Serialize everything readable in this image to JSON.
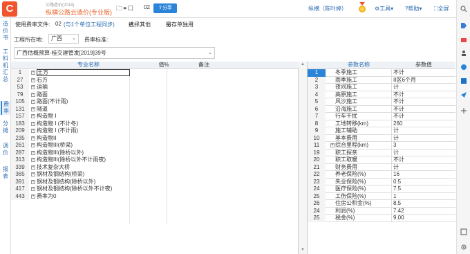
{
  "header": {
    "logo_letter": "C",
    "subtitle": "公路造价(2018)",
    "title": "纵横公路云造价(专业版)",
    "count": "02",
    "share": "分享",
    "user": "纵横（陈叶婷）",
    "menus": [
      "工具",
      "帮助",
      "全屏"
    ]
  },
  "leftnav": [
    {
      "label": "造价书",
      "active": false
    },
    {
      "label": "工料机汇总",
      "active": false
    },
    {
      "label": "费率",
      "active": true
    },
    {
      "label": "分摊",
      "active": false
    },
    {
      "label": "调价",
      "active": false
    },
    {
      "label": "报表",
      "active": false
    }
  ],
  "toolbar": {
    "rate_file_label": "使用费率文件:",
    "rate_file_value": "02",
    "sync_link": "(与1个单位工程同步)",
    "choose_other": "选择其他",
    "save_as": "另存单独用"
  },
  "filters": {
    "region_label": "工程所在地:",
    "region_value": "广西",
    "standard_label": "费率标准:",
    "standard_value": "广西估概预算-桂交建管发[2019]39号"
  },
  "left_table": {
    "headers": [
      "专业名称",
      "值%",
      "备注"
    ],
    "rows": [
      {
        "num": "1",
        "name": "土方"
      },
      {
        "num": "27",
        "name": "石方"
      },
      {
        "num": "53",
        "name": "运输"
      },
      {
        "num": "79",
        "name": "路面"
      },
      {
        "num": "105",
        "name": "路面(不计雨)"
      },
      {
        "num": "131",
        "name": "隧道"
      },
      {
        "num": "157",
        "name": "构造物 I"
      },
      {
        "num": "183",
        "name": "构造物 I (不计冬)"
      },
      {
        "num": "209",
        "name": "构造物 I (不计雨)"
      },
      {
        "num": "235",
        "name": "构造物II"
      },
      {
        "num": "261",
        "name": "构造物III(桥梁)"
      },
      {
        "num": "287",
        "name": "构造物III(除桥以外)"
      },
      {
        "num": "313",
        "name": "构造物III(除桥以外不计雨夜)"
      },
      {
        "num": "339",
        "name": "技术复杂大桥"
      },
      {
        "num": "365",
        "name": "钢材及钢结构(桥梁)"
      },
      {
        "num": "391",
        "name": "钢材及钢结构(除桥以外)"
      },
      {
        "num": "417",
        "name": "钢材及钢结构(除桥以外不计夜)"
      },
      {
        "num": "443",
        "name": "费率为0"
      }
    ]
  },
  "right_table": {
    "headers": [
      "参数名称",
      "参数值"
    ],
    "rows": [
      {
        "num": "1",
        "name": "冬季施工",
        "value": "不计"
      },
      {
        "num": "2",
        "name": "雨季施工",
        "value": "II区6个月"
      },
      {
        "num": "3",
        "name": "夜间施工",
        "value": "计"
      },
      {
        "num": "4",
        "name": "高原施工",
        "value": "不计"
      },
      {
        "num": "5",
        "name": "风沙施工",
        "value": "不计"
      },
      {
        "num": "6",
        "name": "沿海施工",
        "value": "不计"
      },
      {
        "num": "7",
        "name": "行车干扰",
        "value": "不计"
      },
      {
        "num": "8",
        "name": "工地转移(km)",
        "value": "260"
      },
      {
        "num": "9",
        "name": "施工辅助",
        "value": "计"
      },
      {
        "num": "10",
        "name": "基本费用",
        "value": "计"
      },
      {
        "num": "11",
        "name": "综合里程(km)",
        "value": "3"
      },
      {
        "num": "19",
        "name": "职工探亲",
        "value": "计"
      },
      {
        "num": "20",
        "name": "职工取暖",
        "value": "不计"
      },
      {
        "num": "21",
        "name": "财务费用",
        "value": "计"
      },
      {
        "num": "22",
        "name": "养老保险(%)",
        "value": "16"
      },
      {
        "num": "23",
        "name": "失业保险(%)",
        "value": "0.5"
      },
      {
        "num": "24",
        "name": "医疗保险(%)",
        "value": "7.5"
      },
      {
        "num": "25",
        "name": "工伤保险(%)",
        "value": "1"
      },
      {
        "num": "26",
        "name": "住房公积金(%)",
        "value": "8.5"
      },
      {
        "num": "24",
        "name": "利润(%)",
        "value": "7.42"
      },
      {
        "num": "25",
        "name": "税金(%)",
        "value": "9.00"
      }
    ]
  }
}
